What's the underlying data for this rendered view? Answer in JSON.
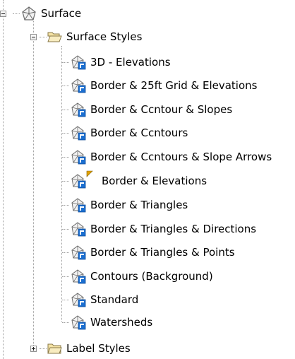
{
  "tree": {
    "root": {
      "label": "Surface",
      "icon": "surface-icon",
      "expanded": true,
      "children": [
        {
          "label": "Surface Styles",
          "icon": "open-folder-icon",
          "expanded": true,
          "items": [
            {
              "label": "3D - Elevations",
              "icon": "surface-style-icon"
            },
            {
              "label": "Border & 25ft Grid & Elevations",
              "icon": "surface-style-icon"
            },
            {
              "label": "Border & Ccntour & Slopes",
              "icon": "surface-style-icon"
            },
            {
              "label": "Border & Ccntours",
              "icon": "surface-style-icon"
            },
            {
              "label": "Border & Ccntours & Slope Arrows",
              "icon": "surface-style-icon"
            },
            {
              "label": "Border & Elevations",
              "icon": "surface-style-default-icon"
            },
            {
              "label": "Border & Triangles",
              "icon": "surface-style-icon"
            },
            {
              "label": "Border & Triangles & Directions",
              "icon": "surface-style-icon"
            },
            {
              "label": "Border & Triangles & Points",
              "icon": "surface-style-icon"
            },
            {
              "label": "Contours (Background)",
              "icon": "surface-style-icon"
            },
            {
              "label": "Standard",
              "icon": "surface-style-icon"
            },
            {
              "label": "Watersheds",
              "icon": "surface-style-icon"
            }
          ]
        },
        {
          "label": "Label Styles",
          "icon": "closed-folder-icon",
          "expanded": false
        }
      ]
    }
  },
  "colors": {
    "connector": "#a0a0a0",
    "folder": "#e8c969",
    "style_badge": "#1b6fd1",
    "default_marker": "#e2a200"
  }
}
